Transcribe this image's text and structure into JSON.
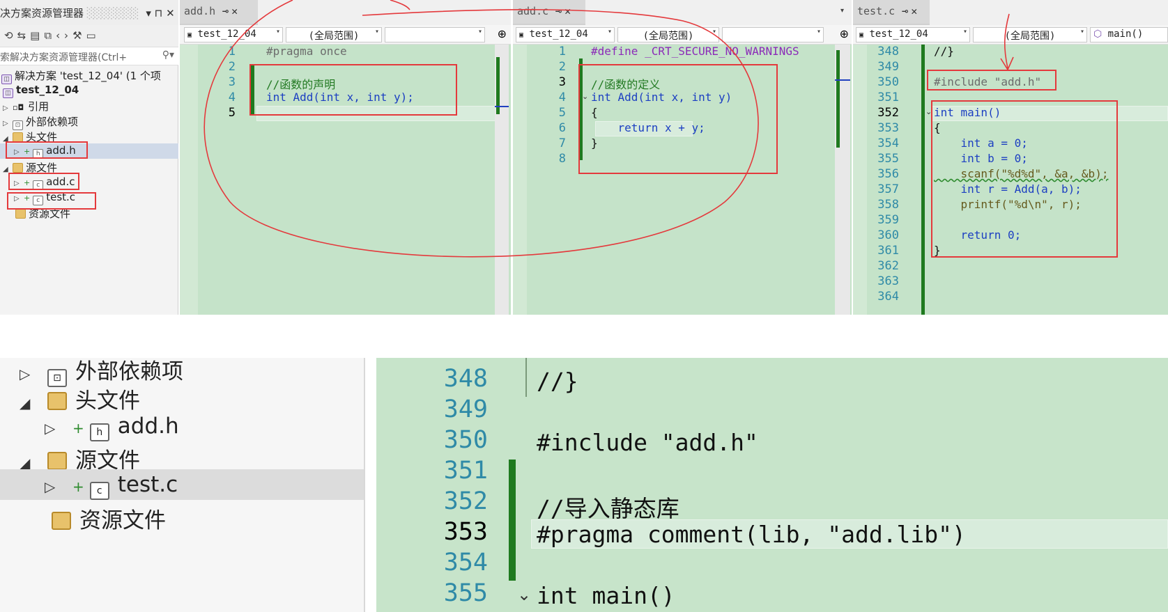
{
  "solution_explorer": {
    "title": "决方案资源管理器",
    "title_controls": "▾ ⊓ ✕",
    "toolbar_icons": [
      "sync-icon",
      "switch-view-icon",
      "collapse-icon",
      "copy-icon",
      "code-icon",
      "wrench-icon",
      "preview-icon"
    ],
    "search_placeholder": "索解决方案资源管理器(Ctrl+",
    "solution_label": "解决方案 'test_12_04' (1 个项",
    "project": "test_12_04",
    "items": [
      {
        "label": "引用"
      },
      {
        "label": "外部依赖项"
      },
      {
        "label": "头文件"
      },
      {
        "label": "add.h"
      },
      {
        "label": "源文件"
      },
      {
        "label": "add.c"
      },
      {
        "label": "test.c"
      },
      {
        "label": "资源文件"
      }
    ]
  },
  "pane_addh": {
    "tab": "add.h",
    "project_dropdown": "test_12_04",
    "scope_dropdown": "(全局范围)",
    "member_dropdown": "",
    "line_numbers": [
      "1",
      "2",
      "3",
      "4",
      "5"
    ],
    "lines": [
      "#pragma once",
      "",
      "//函数的声明",
      "int Add(int x, int y);",
      ""
    ]
  },
  "pane_addc": {
    "tab": "add.c",
    "project_dropdown": "test_12_04",
    "scope_dropdown": "(全局范围)",
    "member_dropdown": "",
    "line_numbers": [
      "1",
      "2",
      "3",
      "4",
      "5",
      "6",
      "7",
      "8"
    ],
    "lines": [
      "#define _CRT_SECURE_NO_WARNINGS",
      "",
      "//函数的定义",
      "int Add(int x, int y)",
      "{",
      "    return x + y;",
      "}",
      ""
    ]
  },
  "pane_testc": {
    "tab": "test.c",
    "project_dropdown": "test_12_04",
    "scope_dropdown": "(全局范围)",
    "member_dropdown": "main()",
    "line_numbers": [
      "348",
      "349",
      "350",
      "351",
      "352",
      "353",
      "354",
      "355",
      "356",
      "357",
      "358",
      "359",
      "360",
      "361",
      "362",
      "363",
      "364"
    ],
    "lines": [
      "//}",
      "",
      "#include \"add.h\"",
      "",
      "int main()",
      "{",
      "    int a = 0;",
      "    int b = 0;",
      "    scanf(\"%d%d\", &a, &b);",
      "    int r = Add(a, b);",
      "    printf(\"%d\\n\", r);",
      "",
      "    return 0;",
      "}",
      "",
      "",
      ""
    ]
  },
  "zoom_view": {
    "tree": [
      {
        "label": "外部依赖项"
      },
      {
        "label": "头文件"
      },
      {
        "label": "add.h"
      },
      {
        "label": "源文件"
      },
      {
        "label": "test.c"
      },
      {
        "label": "资源文件"
      }
    ],
    "line_numbers": [
      "348",
      "349",
      "350",
      "351",
      "352",
      "353",
      "354",
      "355"
    ],
    "lines": [
      "//}",
      "",
      "#include \"add.h\"",
      "",
      "//导入静态库",
      "#pragma comment(lib, \"add.lib\")",
      "",
      "int main()"
    ]
  },
  "colors": {
    "editor_bg": "#c5e3c9",
    "keyword": "#1c3fc2",
    "comment": "#237a23",
    "string": "#a31515",
    "annotation": "#e4393c"
  }
}
